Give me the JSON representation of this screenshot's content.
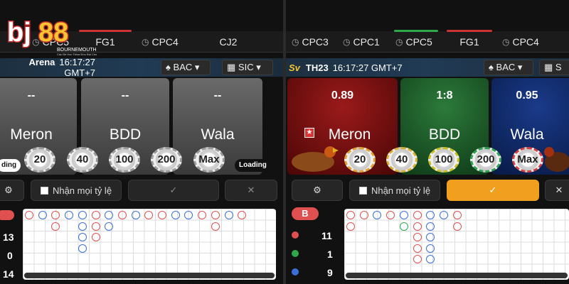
{
  "brand": {
    "logo": "bj88",
    "sub1": "BOURNEMOUTH",
    "sub2": "Các Bé Học Tiếng Đức Bài Cho"
  },
  "left": {
    "tabs": [
      {
        "label": "CPC5",
        "bar": ""
      },
      {
        "label": "FG1",
        "bar": "#cc3333"
      },
      {
        "label": "CPC4",
        "bar": ""
      },
      {
        "label": "CJ2",
        "bar": ""
      }
    ],
    "title": "Arena",
    "time": "16:17:27 GMT+7",
    "dd_bac": "BAC",
    "dd_sic": "SIC",
    "cards": [
      {
        "odds": "--",
        "name": "Meron"
      },
      {
        "odds": "--",
        "name": "BDD"
      },
      {
        "odds": "--",
        "name": "Wala"
      }
    ],
    "chips": [
      "20",
      "40",
      "100",
      "200",
      "Max"
    ],
    "loading_left": "ding",
    "loading_right": "Loading",
    "accept": "Nhận mọi tỷ lệ",
    "counts": [
      "13",
      "0",
      "14"
    ]
  },
  "right": {
    "tabs": [
      {
        "label": "CPC3",
        "bar": ""
      },
      {
        "label": "CPC1",
        "bar": ""
      },
      {
        "label": "CPC5",
        "bar": "#2ea84a"
      },
      {
        "label": "FG1",
        "bar": "#cc3333"
      },
      {
        "label": "CPC4",
        "bar": ""
      }
    ],
    "title": "TH23",
    "time": "16:17:27 GMT+7",
    "dd_bac": "BAC",
    "dd_sic": "S",
    "cards": [
      {
        "odds": "0.89",
        "name": "Meron"
      },
      {
        "odds": "1:8",
        "name": "BDD"
      },
      {
        "odds": "0.95",
        "name": "Wala"
      }
    ],
    "chips": [
      "20",
      "40",
      "100",
      "200",
      "Max"
    ],
    "accept": "Nhận mọi tỷ lệ",
    "badge": "B",
    "counts": [
      "11",
      "1",
      "9"
    ]
  },
  "colors": {
    "red": "#e05050",
    "blue": "#3b6fd8",
    "green": "#2ea84a",
    "confirm": "#f0a01e"
  }
}
